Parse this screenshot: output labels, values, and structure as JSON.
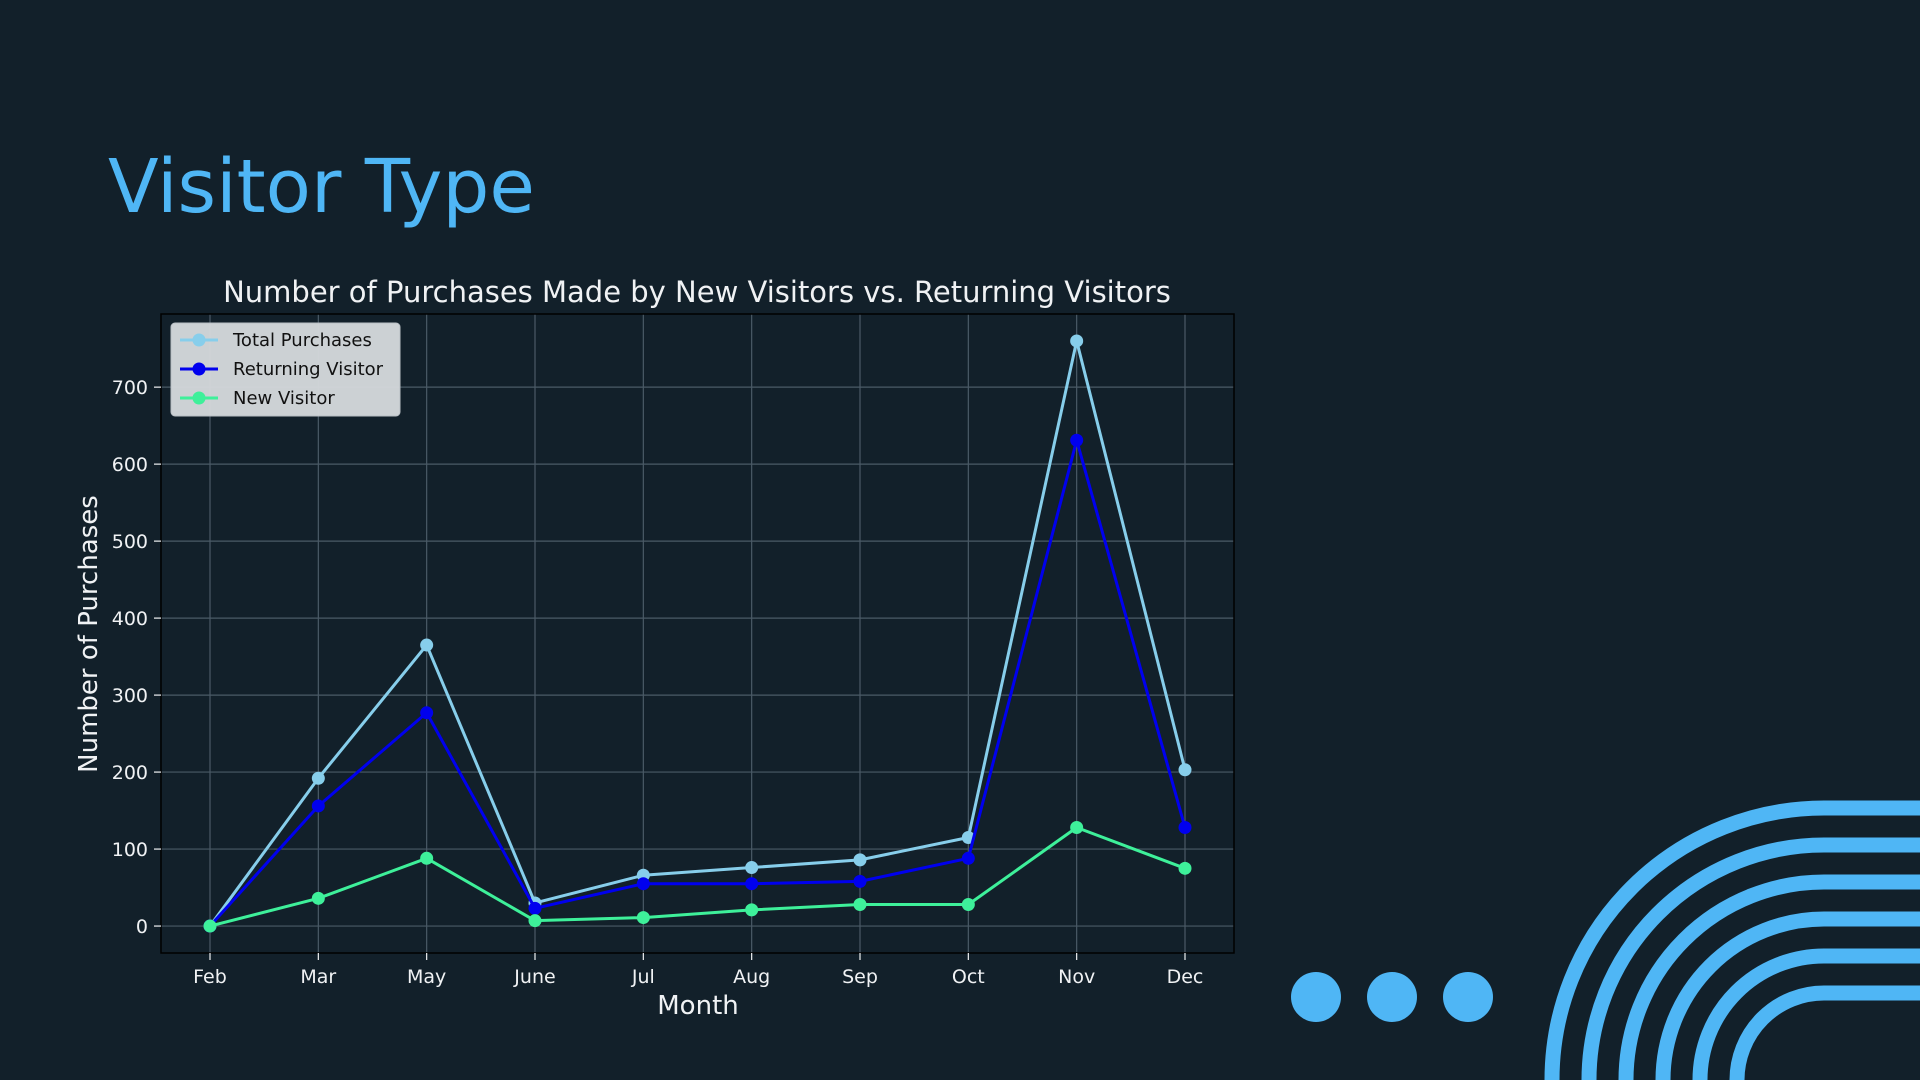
{
  "slide": {
    "title": "Visitor Type"
  },
  "colors": {
    "background": "#12202a",
    "accent": "#4fb6f5",
    "text": "#f0f2f4",
    "grid": "#4a5a66",
    "legend_bg": "#d3d7da"
  },
  "chart_data": {
    "type": "line",
    "title": "Number of Purchases Made by New Visitors vs. Returning Visitors",
    "xlabel": "Month",
    "ylabel": "Number of Purchases",
    "categories": [
      "Feb",
      "Mar",
      "May",
      "June",
      "Jul",
      "Aug",
      "Sep",
      "Oct",
      "Nov",
      "Dec"
    ],
    "ylim": [
      -35,
      795
    ],
    "yticks": [
      0,
      100,
      200,
      300,
      400,
      500,
      600,
      700
    ],
    "grid": true,
    "legend_position": "top-left",
    "series": [
      {
        "name": "Total Purchases",
        "color": "#87ceeb",
        "values": [
          0,
          192,
          365,
          30,
          66,
          76,
          86,
          115,
          760,
          203
        ]
      },
      {
        "name": "Returning Visitor",
        "color": "#0000ee",
        "values": [
          0,
          156,
          277,
          23,
          55,
          55,
          58,
          88,
          631,
          128
        ]
      },
      {
        "name": "New Visitor",
        "color": "#3ef09a",
        "values": [
          0,
          36,
          88,
          7,
          11,
          21,
          28,
          28,
          128,
          75
        ]
      }
    ]
  },
  "decorations": {
    "dot_count": 3,
    "arc_count": 6
  }
}
